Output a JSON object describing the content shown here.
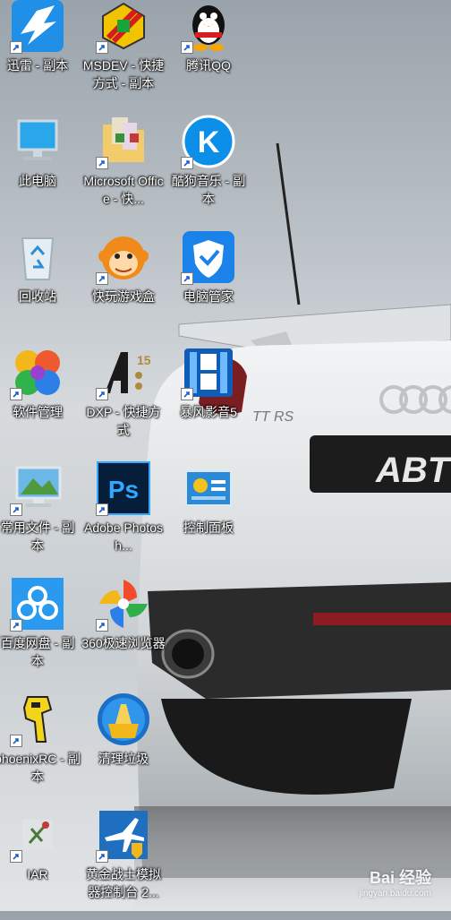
{
  "desktop": {
    "icons": [
      {
        "label": "迅雷 - 副本",
        "icon": "thunder-bird-icon"
      },
      {
        "label": "MSDEV - 快捷方式 - 副本",
        "icon": "msdev-icon"
      },
      {
        "label": "腾讯QQ",
        "icon": "qq-penguin-icon"
      },
      {
        "label": "此电脑",
        "icon": "computer-icon"
      },
      {
        "label": "Microsoft Office - 快...",
        "icon": "office-folder-icon"
      },
      {
        "label": "酷狗音乐 - 副本",
        "icon": "kugou-icon"
      },
      {
        "label": "回收站",
        "icon": "recycle-bin-icon"
      },
      {
        "label": "快玩游戏盒",
        "icon": "monkey-icon"
      },
      {
        "label": "电脑管家",
        "icon": "shield-icon"
      },
      {
        "label": "软件管理",
        "icon": "software-manager-icon"
      },
      {
        "label": "DXP - 快捷方式",
        "icon": "dxp-icon"
      },
      {
        "label": "暴风影音5",
        "icon": "film-icon"
      },
      {
        "label": "常用文件 - 副本",
        "icon": "monitor-folder-icon"
      },
      {
        "label": "Adobe Photosh...",
        "icon": "photoshop-icon"
      },
      {
        "label": "控制面板",
        "icon": "control-panel-icon"
      },
      {
        "label": "百度网盘 - 副本",
        "icon": "cloud-icon"
      },
      {
        "label": "360极速浏览器",
        "icon": "pinwheel-icon"
      },
      {
        "label": "",
        "icon": ""
      },
      {
        "label": "phoenixRC - 副本",
        "icon": "robot-icon"
      },
      {
        "label": "清理垃圾",
        "icon": "broom-icon"
      },
      {
        "label": "",
        "icon": ""
      },
      {
        "label": "IAR",
        "icon": "iar-icon"
      },
      {
        "label": "黄金战士模拟器控制台 2...",
        "icon": "plane-shield-icon"
      }
    ]
  },
  "watermark": {
    "brand": "Bai 经验",
    "url": "jingyan.baidu.com"
  },
  "colors": {
    "label_text": "#ffffff",
    "qq_blue": "#1e78d8",
    "shield_blue": "#1a82e8"
  }
}
